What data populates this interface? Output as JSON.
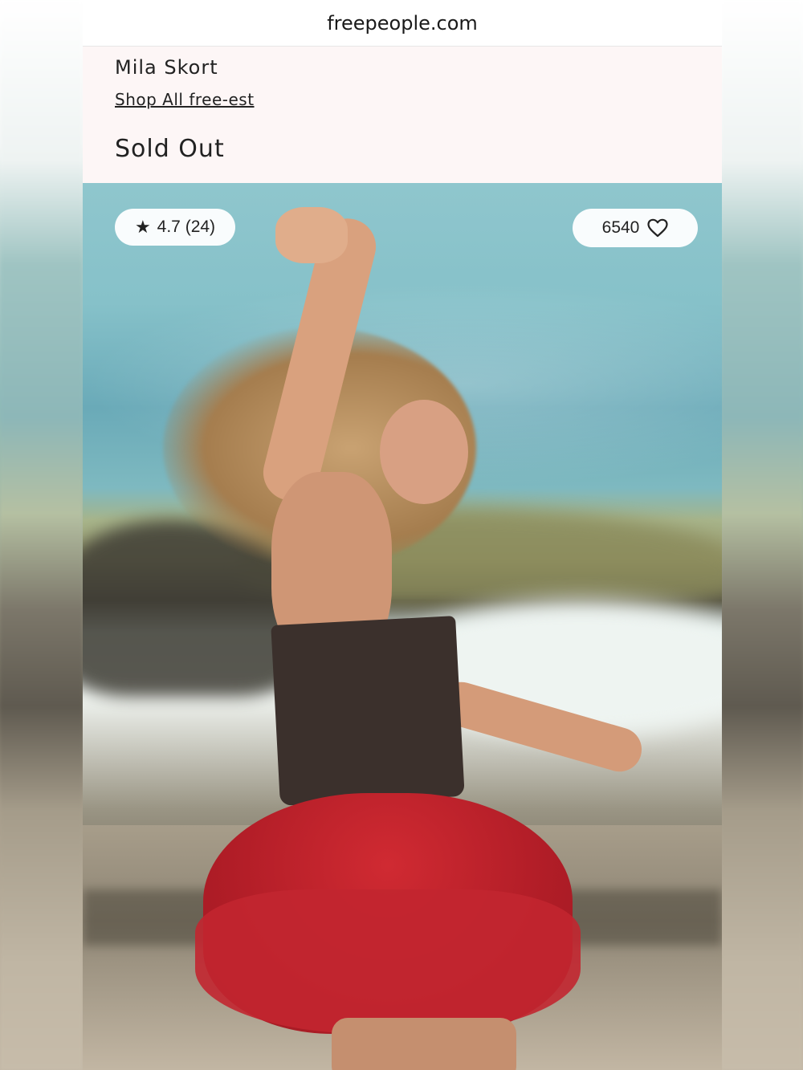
{
  "browser": {
    "url": "freepeople.com"
  },
  "product": {
    "name": "Mila Skort",
    "shop_link": "Shop All free-est",
    "status": "Sold Out"
  },
  "image_overlay": {
    "rating_icon": "star-icon",
    "rating_text": "4.7 (24)",
    "likes_count": "6540",
    "likes_icon": "heart-outline-icon"
  },
  "colors": {
    "info_background": "#fdf6f6",
    "text": "#222222",
    "skirt_red": "#c22630"
  }
}
